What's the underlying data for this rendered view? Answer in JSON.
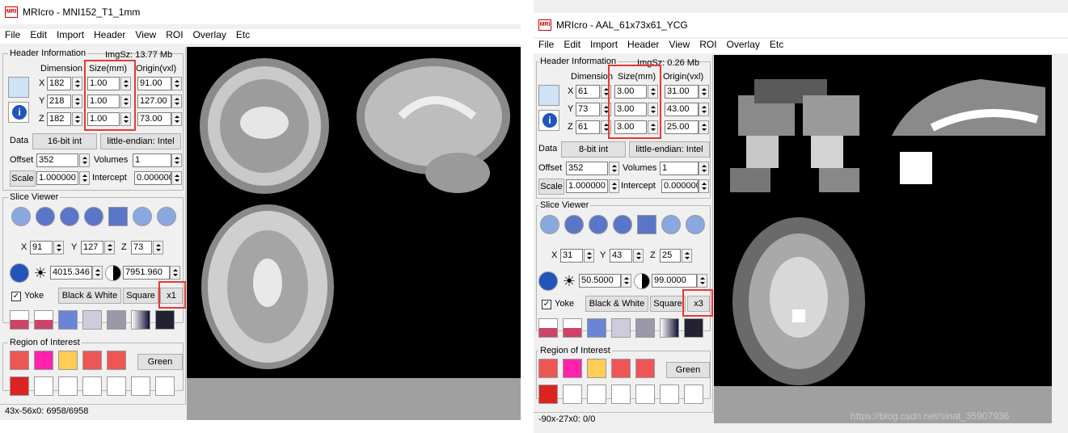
{
  "windows": [
    {
      "title": "MRIcro - MNI152_T1_1mm",
      "menu": [
        "File",
        "Edit",
        "Import",
        "Header",
        "View",
        "ROI",
        "Overlay",
        "Etc"
      ],
      "header": {
        "group_label": "Header Information",
        "imgsz": "ImgSz: 13.77 Mb",
        "col_dimension": "Dimension",
        "col_size": "Size(mm)",
        "col_origin": "Origin(vxl)",
        "rows": [
          {
            "axis": "X",
            "dim": "182",
            "size": "1.00",
            "origin": "91.00"
          },
          {
            "axis": "Y",
            "dim": "218",
            "size": "1.00",
            "origin": "127.00"
          },
          {
            "axis": "Z",
            "dim": "182",
            "size": "1.00",
            "origin": "73.00"
          }
        ],
        "data_label": "Data",
        "data_type": "16-bit int",
        "endian": "little-endian: Intel",
        "offset_label": "Offset",
        "offset": "352",
        "volumes_label": "Volumes",
        "volumes": "1",
        "scale_label": "Scale",
        "scale": "1.000000",
        "intercept_label": "Intercept",
        "intercept": "0.000000"
      },
      "slice": {
        "group_label": "Slice Viewer",
        "x_label": "X",
        "x": "91",
        "y_label": "Y",
        "y": "127",
        "z_label": "Z",
        "z": "73",
        "min": "4015.346",
        "max": "7951.960",
        "yoke": "Yoke",
        "bw": "Black & White",
        "square": "Square",
        "zoom": "x1"
      },
      "roi": {
        "group_label": "Region of Interest",
        "color": "Green"
      },
      "status": "43x-56x0: 6958/6958"
    },
    {
      "title": "MRIcro - AAL_61x73x61_YCG",
      "menu": [
        "File",
        "Edit",
        "Import",
        "Header",
        "View",
        "ROI",
        "Overlay",
        "Etc"
      ],
      "header": {
        "group_label": "Header Information",
        "imgsz": "ImgSz: 0.26 Mb",
        "col_dimension": "Dimension",
        "col_size": "Size(mm)",
        "col_origin": "Origin(vxl)",
        "rows": [
          {
            "axis": "X",
            "dim": "61",
            "size": "3.00",
            "origin": "31.00"
          },
          {
            "axis": "Y",
            "dim": "73",
            "size": "3.00",
            "origin": "43.00"
          },
          {
            "axis": "Z",
            "dim": "61",
            "size": "3.00",
            "origin": "25.00"
          }
        ],
        "data_label": "Data",
        "data_type": "8-bit int",
        "endian": "little-endian: Intel",
        "offset_label": "Offset",
        "offset": "352",
        "volumes_label": "Volumes",
        "volumes": "1",
        "scale_label": "Scale",
        "scale": "1.000000",
        "intercept_label": "Intercept",
        "intercept": "0.000000"
      },
      "slice": {
        "group_label": "Slice Viewer",
        "x_label": "X",
        "x": "31",
        "y_label": "Y",
        "y": "43",
        "z_label": "Z",
        "z": "25",
        "min": "50.5000",
        "max": "99.0000",
        "yoke": "Yoke",
        "bw": "Black & White",
        "square": "Square",
        "zoom": "x3"
      },
      "roi": {
        "group_label": "Region of Interest",
        "color": "Green"
      },
      "status": "-90x-27x0: 0/0"
    }
  ],
  "watermark": "https://blog.csdn.net/sinat_35907936",
  "colors": {
    "highlight": "#e53935",
    "viewer_bg": "#000000",
    "empty_bg": "#a0a0a0"
  }
}
